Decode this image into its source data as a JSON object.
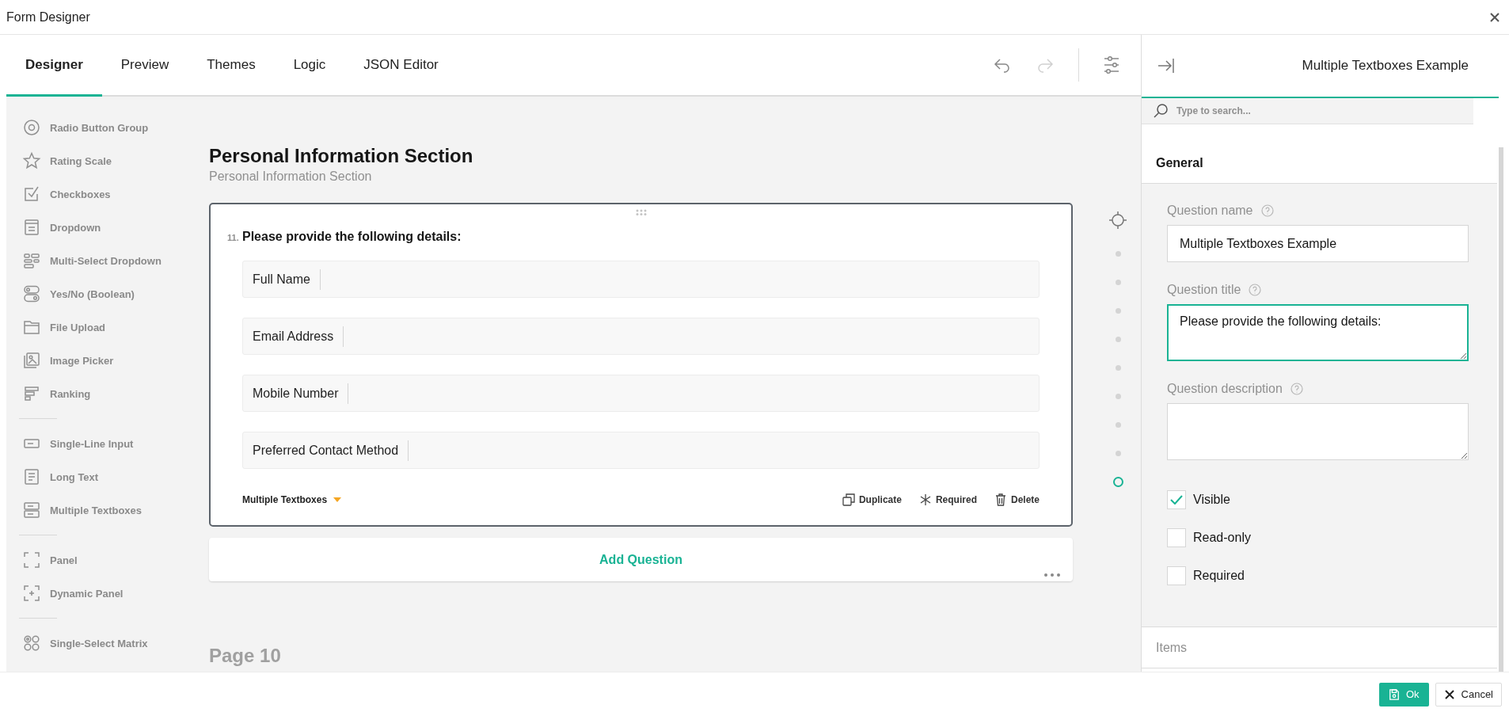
{
  "window": {
    "title": "Form Designer"
  },
  "tabs": [
    {
      "label": "Designer",
      "selected": true
    },
    {
      "label": "Preview",
      "selected": false
    },
    {
      "label": "Themes",
      "selected": false
    },
    {
      "label": "Logic",
      "selected": false
    },
    {
      "label": "JSON Editor",
      "selected": false
    }
  ],
  "toolbar": {
    "undo": {
      "disabled": false
    },
    "redo": {
      "disabled": true
    }
  },
  "toolbox": {
    "groups": [
      [
        {
          "kind": "radiogroup",
          "label": "Radio Button Group"
        },
        {
          "kind": "rating",
          "label": "Rating Scale"
        },
        {
          "kind": "checkbox",
          "label": "Checkboxes"
        },
        {
          "kind": "dropdown",
          "label": "Dropdown"
        },
        {
          "kind": "tagbox",
          "label": "Multi-Select Dropdown"
        },
        {
          "kind": "boolean",
          "label": "Yes/No (Boolean)"
        },
        {
          "kind": "file",
          "label": "File Upload"
        },
        {
          "kind": "imagepicker",
          "label": "Image Picker"
        },
        {
          "kind": "ranking",
          "label": "Ranking"
        }
      ],
      [
        {
          "kind": "text",
          "label": "Single-Line Input"
        },
        {
          "kind": "comment",
          "label": "Long Text"
        },
        {
          "kind": "multipletext",
          "label": "Multiple Textboxes"
        }
      ],
      [
        {
          "kind": "panel",
          "label": "Panel"
        },
        {
          "kind": "paneldynamic",
          "label": "Dynamic Panel"
        }
      ],
      [
        {
          "kind": "matrix",
          "label": "Single-Select Matrix"
        }
      ]
    ]
  },
  "section": {
    "title": "Personal Information Section",
    "description": "Personal Information Section"
  },
  "question": {
    "number": "11.",
    "title": "Please provide the following details:",
    "items": [
      {
        "label": "Full Name"
      },
      {
        "label": "Email Address"
      },
      {
        "label": "Mobile Number"
      },
      {
        "label": "Preferred Contact Method"
      }
    ],
    "type_label": "Multiple Textboxes",
    "actions": [
      {
        "kind": "duplicate",
        "label": "Duplicate"
      },
      {
        "kind": "required",
        "label": "Required"
      },
      {
        "kind": "delete",
        "label": "Delete"
      }
    ]
  },
  "add_question": {
    "label": "Add Question"
  },
  "next_page": {
    "title": "Page 10"
  },
  "navigator": [
    {
      "selected": false
    },
    {
      "selected": false
    },
    {
      "selected": false
    },
    {
      "selected": false
    },
    {
      "selected": false
    },
    {
      "selected": false
    },
    {
      "selected": false
    },
    {
      "selected": false
    },
    {
      "selected": true
    }
  ],
  "property_panel": {
    "title": "Multiple Textboxes Example",
    "search": {
      "placeholder": "Type to search..."
    },
    "categories": [
      {
        "title": "General",
        "expanded": true,
        "properties": [
          {
            "kind": "text",
            "label": "Question name",
            "value": "Multiple Textboxes Example",
            "focused": false
          },
          {
            "kind": "textarea",
            "label": "Question title",
            "value": "Please provide the following details:",
            "focused": true
          },
          {
            "kind": "textarea",
            "label": "Question description",
            "focused": false
          },
          {
            "kind": "checkbox",
            "label": "Visible",
            "checked": true
          },
          {
            "kind": "checkbox",
            "label": "Read-only",
            "checked": false
          },
          {
            "kind": "checkbox",
            "label": "Required",
            "checked": false
          }
        ]
      },
      {
        "title": "Items",
        "expanded": false
      }
    ]
  },
  "footer": {
    "buttons": [
      {
        "kind": "primary",
        "label": "Ok"
      },
      {
        "kind": "secondary",
        "label": "Cancel"
      }
    ]
  }
}
